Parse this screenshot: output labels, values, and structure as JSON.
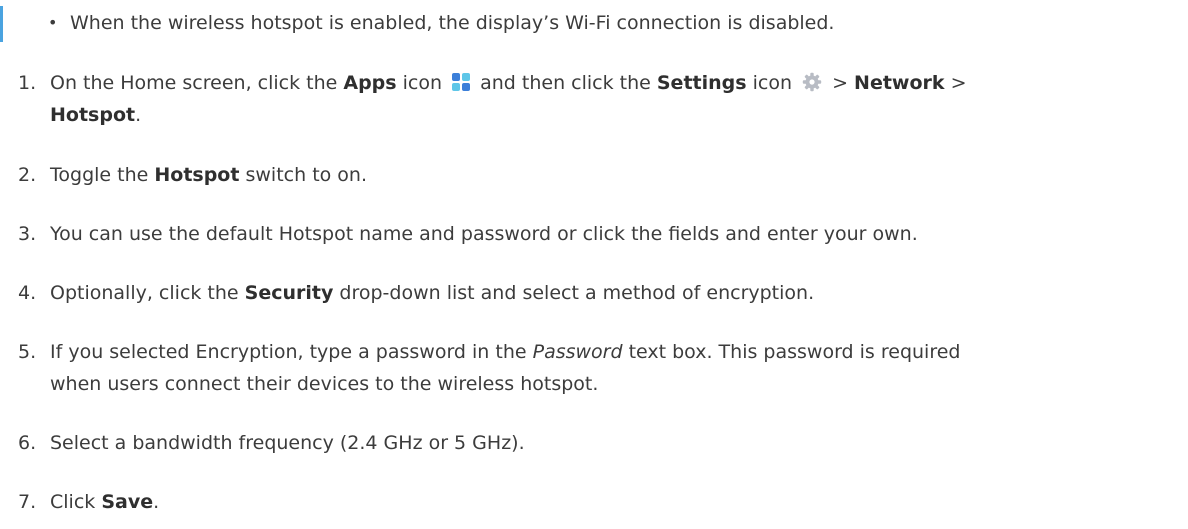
{
  "note": {
    "bullet": "•",
    "text": "When the wireless hotspot is enabled, the display’s Wi-Fi connection is disabled."
  },
  "steps": [
    {
      "num": "1.",
      "p1": "On the Home screen, click the ",
      "b1": "Apps",
      "p2": " icon ",
      "p3": " and then click the ",
      "b2": "Settings",
      "p4": " icon ",
      "p5": " > ",
      "b3": "Network",
      "p6": " >",
      "b4": "Hotspot",
      "p7": "."
    },
    {
      "num": "2.",
      "p1": "Toggle the ",
      "b1": "Hotspot",
      "p2": " switch to on."
    },
    {
      "num": "3.",
      "p1": "You can use the default Hotspot name and password or click the fields and enter your own."
    },
    {
      "num": "4.",
      "p1": "Optionally, click the ",
      "b1": "Security",
      "p2": " drop-down list and select a method of encryption."
    },
    {
      "num": "5.",
      "p1": "If you selected Encryption, type a password in the ",
      "i1": "Password",
      "p2": " text box. This password is required",
      "p3": "when users connect their devices to the wireless hotspot."
    },
    {
      "num": "6.",
      "p1": "Select a bandwidth frequency (2.4 GHz or 5 GHz)."
    },
    {
      "num": "7.",
      "p1": "Click ",
      "b1": "Save",
      "p2": "."
    }
  ],
  "icons": {
    "apps": "apps-icon",
    "settings": "gear-icon"
  },
  "colors": {
    "accent": "#4aa3e0",
    "apps_dark": "#3b7fd9",
    "apps_light": "#5ec6e8",
    "gear": "#b8bcc4",
    "text": "#3c3c3c"
  }
}
